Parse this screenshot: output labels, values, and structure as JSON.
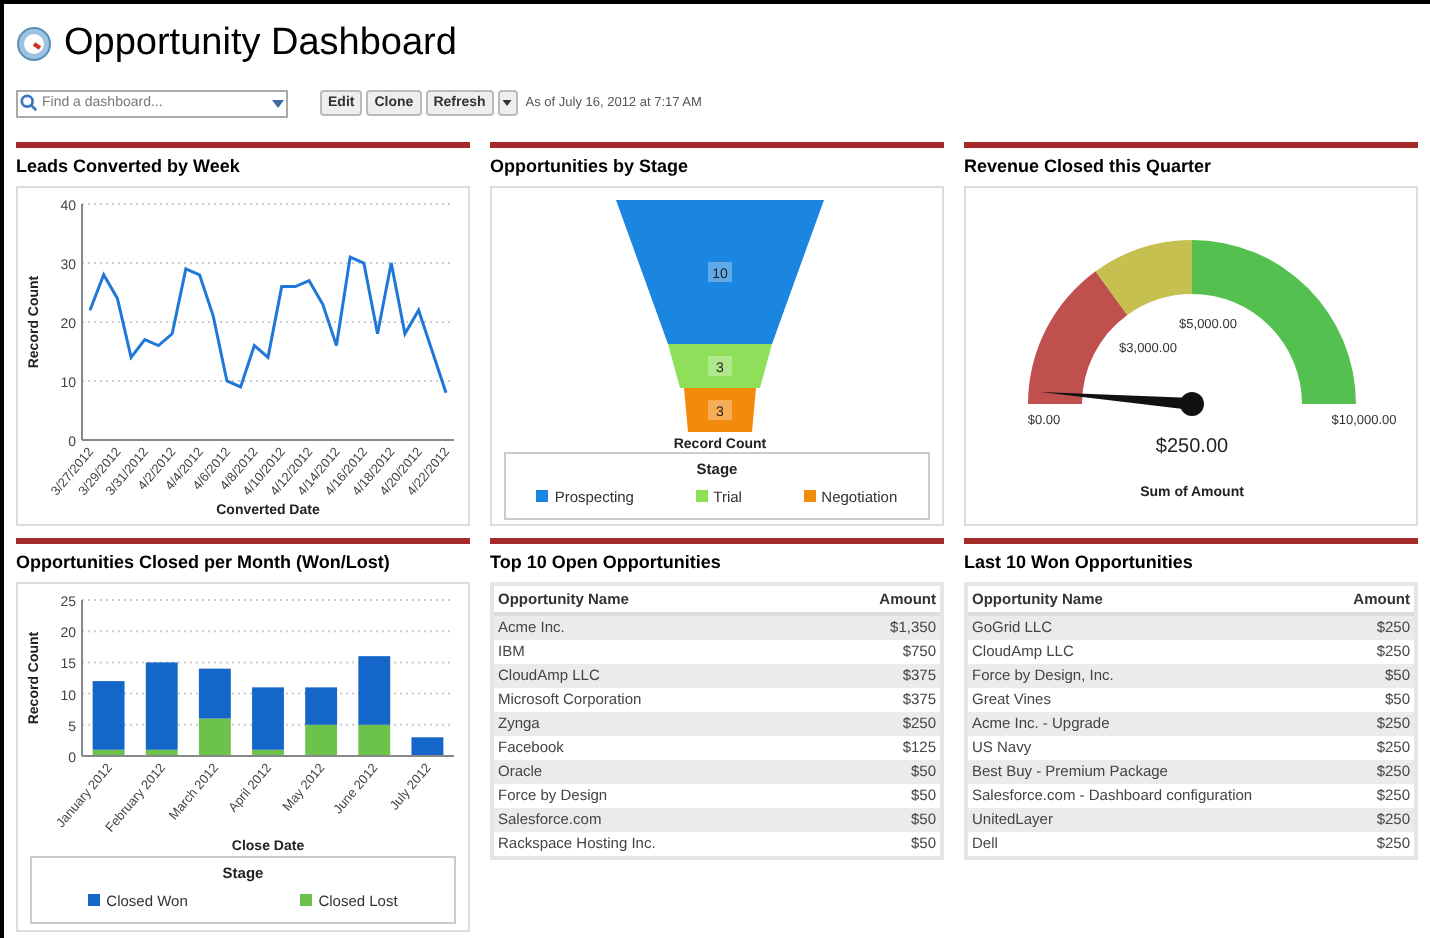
{
  "title": "Opportunity Dashboard",
  "toolbar": {
    "search": {
      "placeholder": "Find a dashboard..."
    },
    "buttons": [
      "Edit",
      "Clone",
      "Refresh"
    ],
    "timestamp": "As of July 16, 2012 at 7:17 AM"
  },
  "leads_chart": {
    "title": "Leads Converted by Week",
    "chart_data": {
      "type": "line",
      "xlabel": "Converted Date",
      "ylabel": "Record Count",
      "grid": true,
      "categories": [
        "3/27/2012",
        null,
        "3/29/2012",
        null,
        "3/31/2012",
        null,
        "4/2/2012",
        null,
        "4/4/2012",
        null,
        "4/6/2012",
        null,
        "4/8/2012",
        null,
        "4/10/2012",
        null,
        "4/12/2012",
        null,
        "4/14/2012",
        null,
        "4/16/2012",
        null,
        "4/18/2012",
        null,
        "4/20/2012",
        null,
        "4/22/2012"
      ],
      "series": [
        {
          "color": "#1f78d8",
          "values": [
            22,
            28,
            24,
            14,
            17,
            16,
            18,
            29,
            28,
            21,
            10,
            9,
            16,
            14,
            26,
            26,
            27,
            23,
            16,
            31,
            30,
            18,
            30,
            18,
            22,
            15,
            8
          ]
        }
      ],
      "ylim": [
        0,
        40
      ],
      "yticks": [
        0,
        10,
        20,
        30,
        40
      ]
    }
  },
  "stage_chart": {
    "title": "Opportunities by Stage",
    "segments": [
      {
        "value": "10",
        "color": "#1a86e0"
      },
      {
        "value": "3",
        "color": "#8ee05a"
      },
      {
        "value": "3",
        "color": "#f28a0c"
      }
    ],
    "xlabel": "Record Count",
    "legend": {
      "title": "Stage",
      "items": [
        {
          "label": "Prospecting",
          "color": "#1a86e0"
        },
        {
          "label": "Trial",
          "color": "#8ee05a"
        },
        {
          "label": "Negotiation",
          "color": "#f28a0c"
        }
      ]
    }
  },
  "revenue_gauge": {
    "title": "Revenue Closed this Quarter",
    "bands": [
      {
        "color": "#c0504d"
      },
      {
        "color": "#c6c050"
      },
      {
        "color": "#54c04f"
      }
    ],
    "ticks": [
      "$0.00",
      "$3,000.00",
      "$5,000.00",
      "$10,000.00"
    ],
    "reading": "$250.00",
    "caption": "Sum of Amount"
  },
  "closed_chart": {
    "title": "Opportunities Closed per Month (Won/Lost)",
    "legend_title": "Stage",
    "chart_data": {
      "type": "bar",
      "stacked": true,
      "grid": true,
      "xlabel": "Close Date",
      "ylabel": "Record Count",
      "categories": [
        "January 2012",
        "February 2012",
        "March 2012",
        "April 2012",
        "May 2012",
        "June 2012",
        "July 2012"
      ],
      "series": [
        {
          "name": "Closed Won",
          "color": "#1466c8",
          "values": [
            11,
            14,
            8,
            10,
            6,
            11,
            3
          ]
        },
        {
          "name": "Closed Lost",
          "color": "#6cc24a",
          "values": [
            1,
            1,
            6,
            1,
            5,
            5,
            0
          ]
        }
      ],
      "ylim": [
        0,
        25
      ],
      "yticks": [
        0,
        5,
        10,
        15,
        20,
        25
      ]
    }
  },
  "open_table": {
    "title": "Top 10 Open Opportunities",
    "columns": [
      "Opportunity Name",
      "Amount"
    ],
    "rows": [
      [
        "Acme Inc.",
        "$1,350"
      ],
      [
        "IBM",
        "$750"
      ],
      [
        "CloudAmp LLC",
        "$375"
      ],
      [
        "Microsoft Corporation",
        "$375"
      ],
      [
        "Zynga",
        "$250"
      ],
      [
        "Facebook",
        "$125"
      ],
      [
        "Oracle",
        "$50"
      ],
      [
        "Force by Design",
        "$50"
      ],
      [
        "Salesforce.com",
        "$50"
      ],
      [
        "Rackspace Hosting Inc.",
        "$50"
      ]
    ]
  },
  "won_table": {
    "title": "Last 10 Won Opportunities",
    "columns": [
      "Opportunity Name",
      "Amount"
    ],
    "rows": [
      [
        "GoGrid LLC",
        "$250"
      ],
      [
        "CloudAmp LLC",
        "$250"
      ],
      [
        "Force by Design, Inc.",
        "$50"
      ],
      [
        "Great Vines",
        "$50"
      ],
      [
        "Acme Inc. - Upgrade",
        "$250"
      ],
      [
        "US Navy",
        "$250"
      ],
      [
        "Best Buy - Premium Package",
        "$250"
      ],
      [
        "Salesforce.com - Dashboard configuration",
        "$250"
      ],
      [
        "UnitedLayer",
        "$250"
      ],
      [
        "Dell",
        "$250"
      ]
    ]
  }
}
